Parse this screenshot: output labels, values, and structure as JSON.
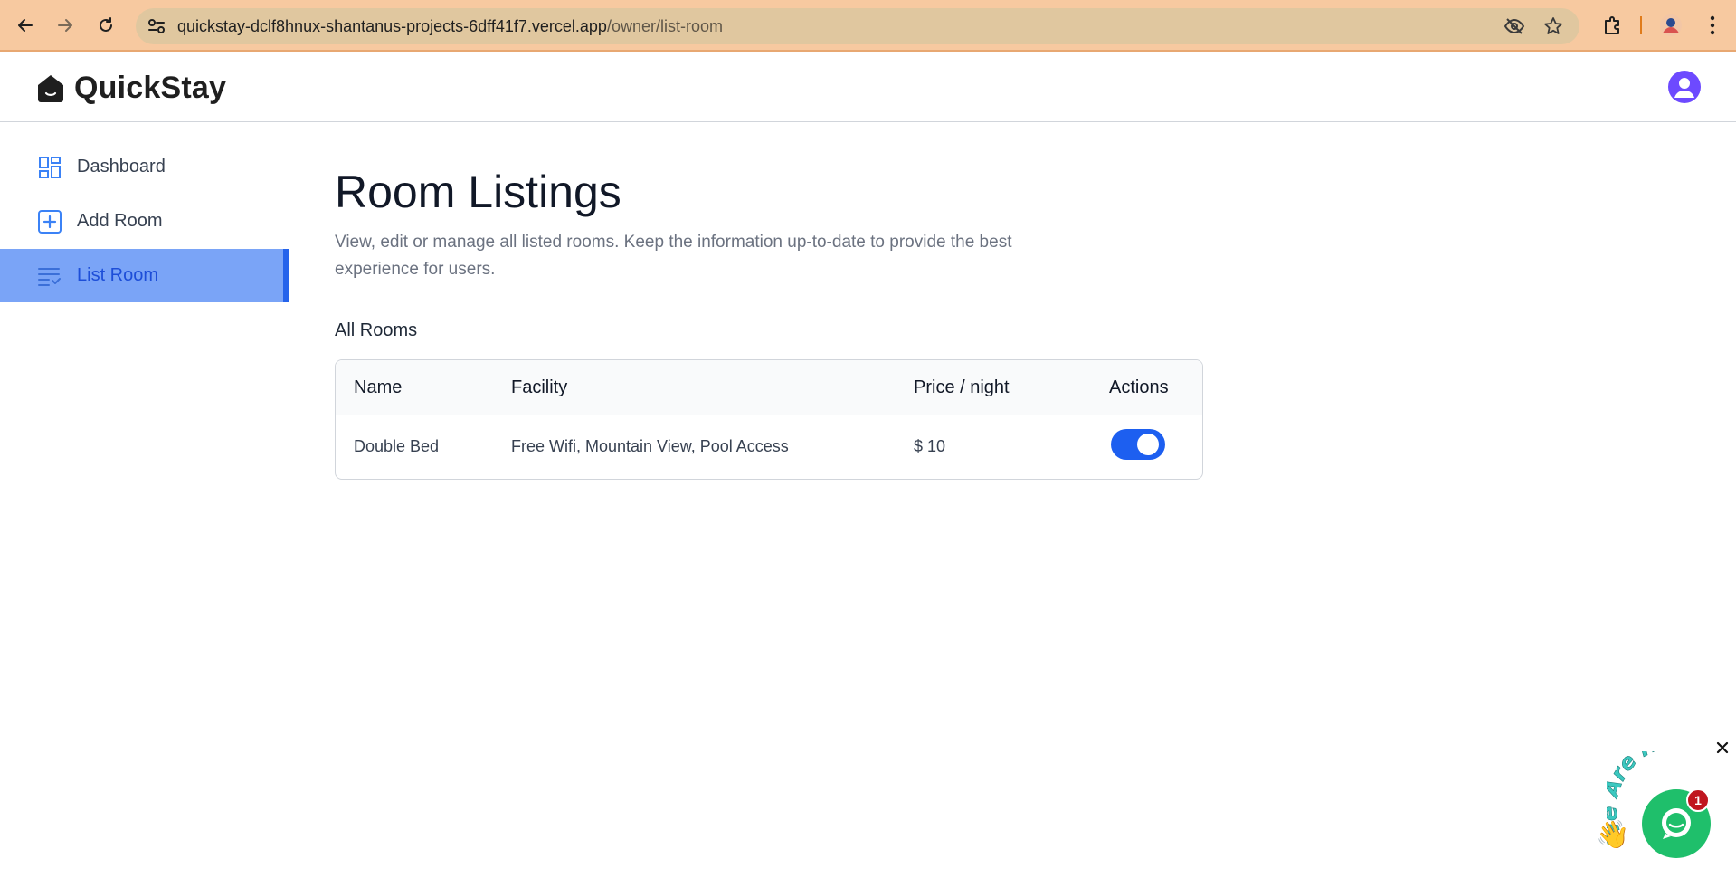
{
  "browser": {
    "url_host": "quickstay-dclf8hnux-shantanus-projects-6dff41f7.vercel.app",
    "url_path": "/owner/list-room"
  },
  "app": {
    "name": "QuickStay"
  },
  "sidebar": {
    "items": [
      {
        "label": "Dashboard",
        "icon": "dashboard-icon",
        "active": false
      },
      {
        "label": "Add Room",
        "icon": "add-square-icon",
        "active": false
      },
      {
        "label": "List Room",
        "icon": "list-icon",
        "active": true
      }
    ]
  },
  "main": {
    "title": "Room Listings",
    "description": "View, edit or manage all listed rooms. Keep the information up-to-date to provide the best experience for users.",
    "section_label": "All Rooms",
    "table": {
      "headers": [
        "Name",
        "Facility",
        "Price / night",
        "Actions"
      ],
      "rows": [
        {
          "name": "Double Bed",
          "facility": "Free Wifi, Mountain View, Pool Access",
          "price": "$ 10",
          "available": true
        }
      ]
    }
  },
  "chat": {
    "banner_text": "We Are Here!",
    "unread_count": "1"
  },
  "colors": {
    "accent": "#2563eb",
    "active_bg": "#7aa4f7",
    "chat_green": "#1fbf6b",
    "browser_bar": "#f7c9a0"
  }
}
